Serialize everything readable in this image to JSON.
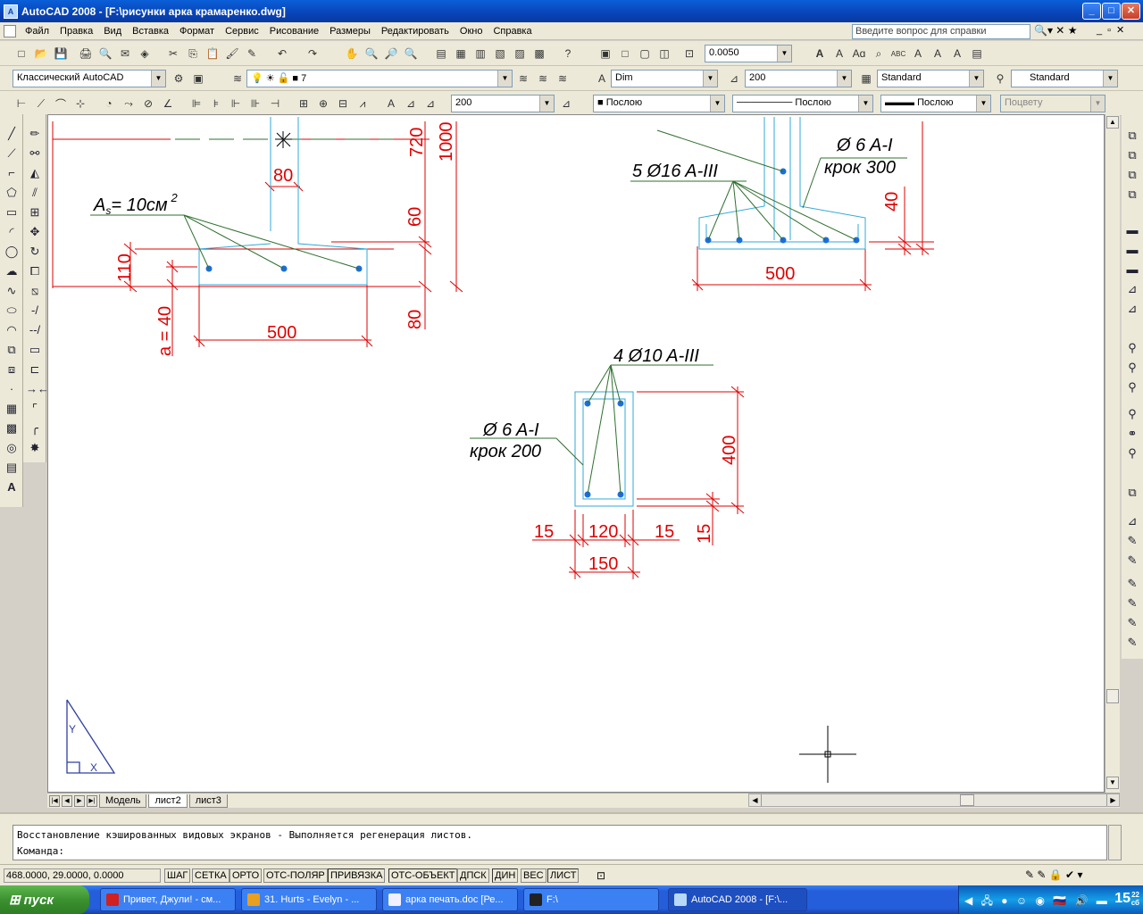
{
  "window": {
    "title": "AutoCAD 2008 - [F:\\рисунки арка крамаренко.dwg]"
  },
  "menu": [
    "Файл",
    "Правка",
    "Вид",
    "Вставка",
    "Формат",
    "Сервис",
    "Рисование",
    "Размеры",
    "Редактировать",
    "Окно",
    "Справка"
  ],
  "help": {
    "placeholder": "Введите вопрос для справки"
  },
  "toolbar1": {
    "scale_value": "0.0050"
  },
  "toolbar2": {
    "workspace": "Классический AutoCAD",
    "layer": "7",
    "dimstyle": "Dim",
    "textheight": "200",
    "textstyle": "Standard",
    "tablestyle": "Standard"
  },
  "toolbar3": {
    "dimvalue": "200",
    "color": "Послою",
    "linetype": "Послою",
    "lineweight": "Послою",
    "plotstyle": "Поцвету"
  },
  "drawing": {
    "labels": {
      "as_label": "A",
      "as_sub": "s",
      "as_value": "= 10см",
      "as_sup": "2",
      "d80_top": "80",
      "d720": "720",
      "d1000": "1000",
      "d60": "60",
      "d110": "110",
      "d80_bottom": "80",
      "a40": "a = 40",
      "d500_left": "500",
      "bars_right": "5 Ø16 A-III",
      "stir_right_1": "Ø 6 A-I",
      "stir_right_2": "крок 300",
      "d40": "40",
      "d500_right": "500",
      "bars_center": "4 Ø10 A-III",
      "stir_center_1": "Ø 6 A-I",
      "stir_center_2": "крок 200",
      "d400": "400",
      "d15_left": "15",
      "d120": "120",
      "d15_right": "15",
      "d15_vert": "15",
      "d150": "150",
      "ucs_y": "Y",
      "ucs_x": "X"
    }
  },
  "tabs": [
    "Модель",
    "лист2",
    "лист3"
  ],
  "command": {
    "history": "Восстановление кэшированных видовых экранов - Выполняется регенерация листов.",
    "prompt": "Команда:"
  },
  "status": {
    "coords": "468.0000, 29.0000, 0.0000",
    "buttons": [
      "ШАГ",
      "СЕТКА",
      "ОРТО",
      "ОТС-ПОЛЯР",
      "ПРИВЯЗКА",
      "ОТС-ОБЪЕКТ",
      "ДПСК",
      "ДИН",
      "ВЕС",
      "ЛИСТ"
    ]
  },
  "taskbar": {
    "start": "пуск",
    "tasks": [
      "Привет, Джули! - см...",
      "31. Hurts - Evelyn - ...",
      "арка печать.doc [Ре...",
      "F:\\",
      "AutoCAD 2008 - [F:\\..."
    ],
    "clock": "15",
    "clock_small": "22",
    "clock_small2": "сб"
  },
  "colors": {
    "red": "#e00000",
    "cyan": "#30a8d8",
    "green": "#2f6f2f",
    "blue": "#1a6ee0"
  }
}
